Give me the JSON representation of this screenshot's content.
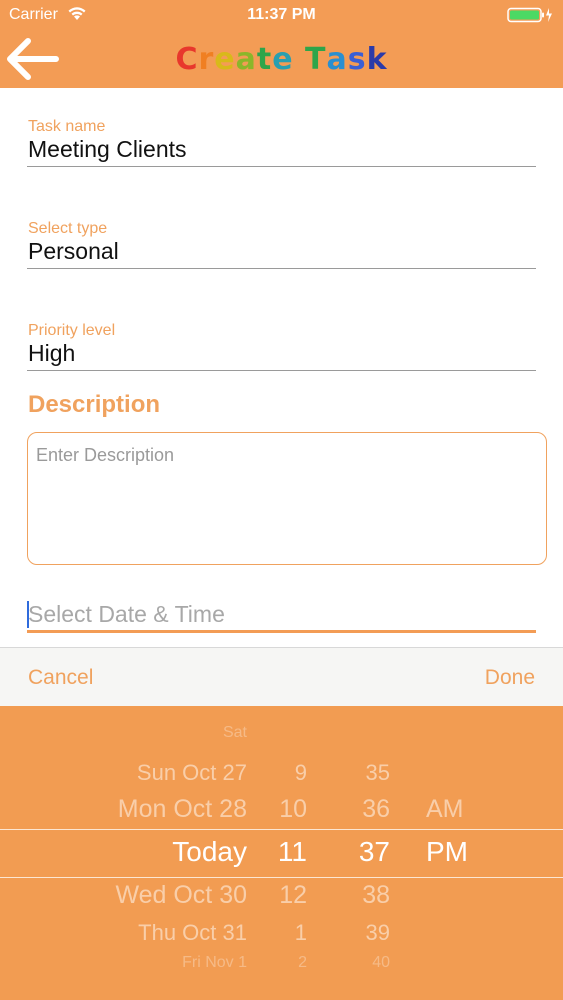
{
  "status_bar": {
    "carrier": "Carrier",
    "time": "11:37 PM"
  },
  "nav": {
    "back_icon": "arrow-left-icon",
    "title_letters": [
      {
        "ch": "C",
        "color": "#e8372c"
      },
      {
        "ch": "r",
        "color": "#f07f22"
      },
      {
        "ch": "e",
        "color": "#d8b91a"
      },
      {
        "ch": "a",
        "color": "#8ab62a"
      },
      {
        "ch": "t",
        "color": "#2ea54a"
      },
      {
        "ch": "e",
        "color": "#2a9fb0"
      },
      {
        "ch": " ",
        "color": "#ffffff"
      },
      {
        "ch": "T",
        "color": "#2ea54a"
      },
      {
        "ch": "a",
        "color": "#2a8fd0"
      },
      {
        "ch": "s",
        "color": "#3a5fd5"
      },
      {
        "ch": "k",
        "color": "#2b3aa8"
      }
    ]
  },
  "form": {
    "task_name": {
      "label": "Task name",
      "value": "Meeting Clients"
    },
    "select_type": {
      "label": "Select type",
      "value": "Personal"
    },
    "priority": {
      "label": "Priority level",
      "value": "High"
    },
    "description_heading": "Description",
    "description_placeholder": "Enter Description",
    "date_placeholder": "Select Date & Time"
  },
  "picker_toolbar": {
    "cancel": "Cancel",
    "done": "Done"
  },
  "picker": {
    "rows": [
      {
        "date": "Sat",
        "hour": "",
        "minute": "",
        "ampm": ""
      },
      {
        "date": "Sun Oct 27",
        "hour": "9",
        "minute": "35",
        "ampm": ""
      },
      {
        "date": "Mon Oct 28",
        "hour": "10",
        "minute": "36",
        "ampm": "AM"
      },
      {
        "date": "Today",
        "hour": "11",
        "minute": "37",
        "ampm": "PM"
      },
      {
        "date": "Wed Oct 30",
        "hour": "12",
        "minute": "38",
        "ampm": ""
      },
      {
        "date": "Thu Oct 31",
        "hour": "1",
        "minute": "39",
        "ampm": ""
      },
      {
        "date": "Fri Nov 1",
        "hour": "2",
        "minute": "40",
        "ampm": ""
      }
    ],
    "selected_index": 3
  },
  "colors": {
    "accent": "#f39c55",
    "label": "#f0a25e"
  }
}
